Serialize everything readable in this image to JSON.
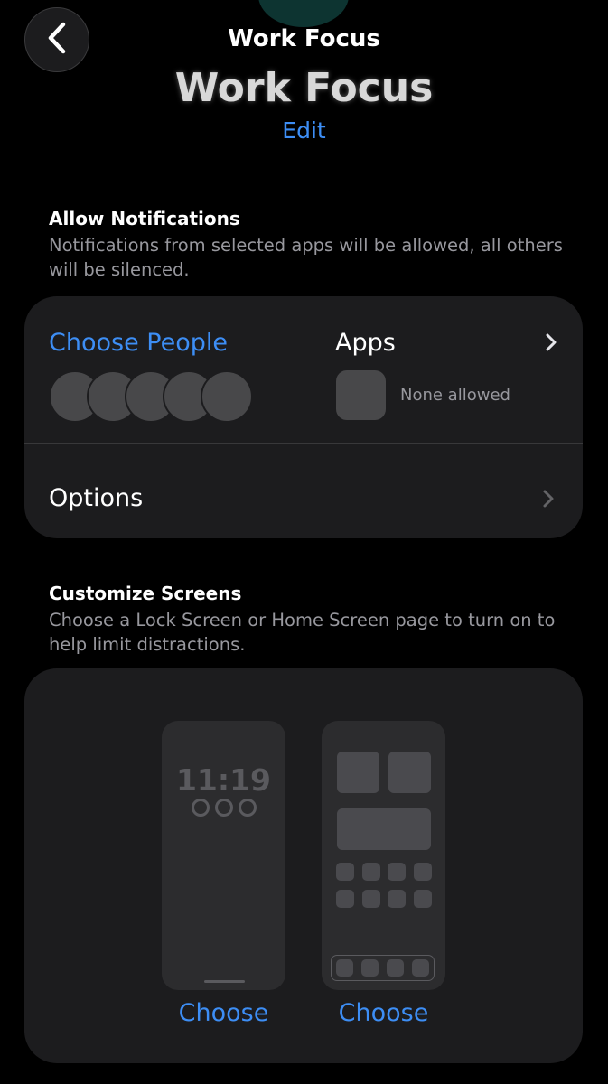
{
  "header": {
    "nav_title": "Work Focus",
    "large_title": "Work Focus",
    "edit_label": "Edit"
  },
  "allow_notifications": {
    "title": "Allow Notifications",
    "description": "Notifications from selected apps will be allowed, all others will be silenced.",
    "choose_people_label": "Choose People",
    "apps_label": "Apps",
    "apps_status": "None allowed",
    "options_label": "Options"
  },
  "customize_screens": {
    "title": "Customize Screens",
    "description": "Choose a Lock Screen or Home Screen page to turn on to help limit distractions.",
    "lock_screen_time": "11:19",
    "lock_screen_choose_label": "Choose",
    "home_screen_choose_label": "Choose"
  },
  "icons": {
    "back": "chevron-left-icon",
    "apps_disclosure": "chevron-right-icon",
    "options_disclosure": "chevron-right-icon"
  },
  "colors": {
    "accent": "#3d8ef5",
    "background": "#000000",
    "card": "#1c1c1e",
    "secondary_text": "#98989e",
    "placeholder": "#48484a"
  }
}
